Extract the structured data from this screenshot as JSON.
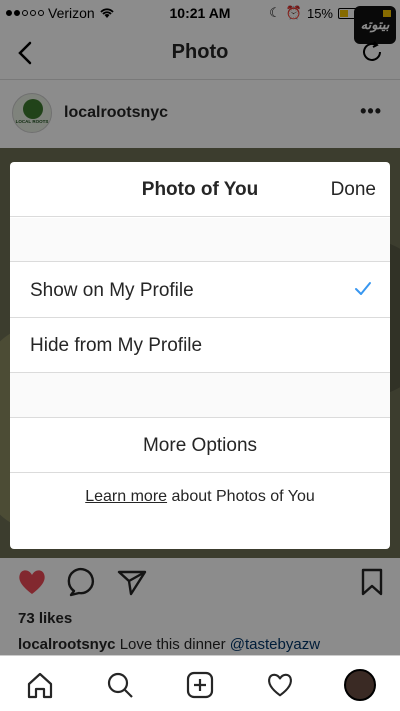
{
  "status_bar": {
    "carrier": "Verizon",
    "time": "10:21 AM",
    "battery_percent": "15%",
    "watermark": "بیتوته"
  },
  "nav": {
    "title": "Photo"
  },
  "post": {
    "username": "localrootsnyc",
    "more": "•••",
    "avatar_text": "LOCAL ROOTS",
    "likes": "73 likes",
    "caption_user": "localrootsnyc",
    "caption_text": "Love this dinner",
    "caption_mention": "@tastebyazw"
  },
  "sheet": {
    "title": "Photo of You",
    "done_label": "Done",
    "options": [
      {
        "label": "Show on My Profile",
        "selected": true
      },
      {
        "label": "Hide from My Profile",
        "selected": false
      }
    ],
    "more_options_label": "More Options",
    "learn_more_link": "Learn more",
    "learn_more_text": "about Photos of You"
  },
  "icons": {
    "back": "chevron-left-icon",
    "refresh": "refresh-icon",
    "like": "heart-icon",
    "comment": "comment-icon",
    "share": "send-icon",
    "save": "bookmark-icon",
    "check": "checkmark-icon",
    "home": "home-icon",
    "search": "search-icon",
    "add": "add-post-icon",
    "activity": "heart-outline-icon",
    "profile": "profile-avatar"
  },
  "colors": {
    "like_red": "#ed4956",
    "check_blue": "#3897f0",
    "mention_blue": "#003569"
  }
}
